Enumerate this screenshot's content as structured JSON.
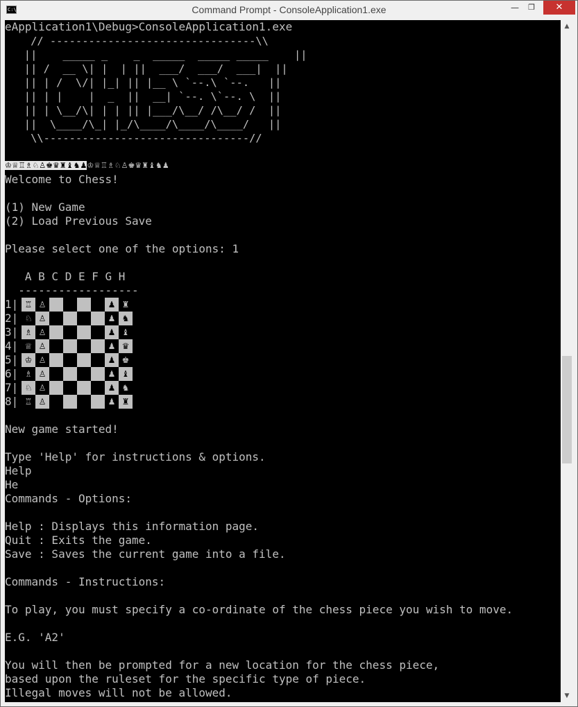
{
  "window": {
    "title": "Command Prompt - ConsoleApplication1.exe",
    "icon_text": "C:\\.",
    "min_glyph": "—",
    "max_glyph": "❐",
    "close_glyph": "✕"
  },
  "scrollbar": {
    "up_glyph": "▲",
    "down_glyph": "▼"
  },
  "console": {
    "path_line": "eApplication1\\Debug>ConsoleApplication1.exe",
    "art": [
      "    // --------------------------------\\\\",
      "   ||    _____ _    _  _____  _____ _____    ||",
      "   || /  __ \\| |  | ||  ___/  ___/  ___|  ||",
      "   || | /  \\/| |_| || |__ \\ `--.\\ `--.   ||",
      "   || | |    |  _  ||  __| `--. \\`--. \\  ||",
      "   || | \\__/\\| | | || |___/\\__/ /\\__/ /  ||",
      "   ||  \\____/\\_| |_/\\____/\\____/\\____/   ||",
      "    \\\\--------------------------------//"
    ],
    "pieces_highlight": "♔♕♖♗♘♙♚♛♜♝♞♟",
    "pieces_rest": "♔♕♖♗♘♙♚♛♜♝♞♟",
    "welcome": "Welcome to Chess!",
    "opt1": "(1) New Game",
    "opt2": "(2) Load Previous Save",
    "prompt": "Please select one of the options: 1",
    "board_header": "   A B C D E F G H",
    "board_rule": "  ------------------",
    "row_labels": [
      "1|",
      "2|",
      "3|",
      "4|",
      "5|",
      "6|",
      "7|",
      "8|"
    ],
    "board": [
      [
        "♖",
        "♙",
        "",
        "",
        "",
        "",
        "♟",
        "♜"
      ],
      [
        "♘",
        "♙",
        "",
        "",
        "",
        "",
        "♟",
        "♞"
      ],
      [
        "♗",
        "♙",
        "",
        "",
        "",
        "",
        "♟",
        "♝"
      ],
      [
        "♕",
        "♙",
        "",
        "",
        "",
        "",
        "♟",
        "♛"
      ],
      [
        "♔",
        "♙",
        "",
        "",
        "",
        "",
        "♟",
        "♚"
      ],
      [
        "♗",
        "♙",
        "",
        "",
        "",
        "",
        "♟",
        "♝"
      ],
      [
        "♘",
        "♙",
        "",
        "",
        "",
        "",
        "♟",
        "♞"
      ],
      [
        "♖",
        "♙",
        "",
        "",
        "",
        "",
        "♟",
        "♜"
      ]
    ],
    "new_game": "New game started!",
    "help_hint": "Type 'Help' for instructions & options.",
    "input1": "Help",
    "input2": "He",
    "cmd_options_header": "Commands - Options:",
    "help_line": "Help : Displays this information page.",
    "quit_line": "Quit : Exits the game.",
    "save_line": "Save : Saves the current game into a file.",
    "cmd_instr_header": "Commands - Instructions:",
    "instr1": "To play, you must specify a co-ordinate of the chess piece you wish to move.",
    "example": "E.G. 'A2'",
    "instr2": "You will then be prompted for a new location for the chess piece,",
    "instr3": "based upon the ruleset for the specific type of piece.",
    "instr4": "Illegal moves will not be allowed."
  }
}
